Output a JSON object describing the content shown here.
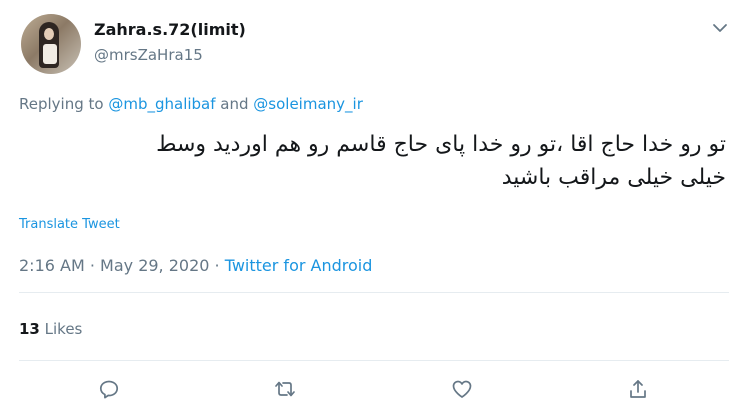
{
  "user": {
    "display_name": "Zahra.s.72(limit)",
    "handle": "@mrsZaHra15"
  },
  "reply": {
    "prefix": "Replying to ",
    "mention_1": "@mb_ghalibaf",
    "joiner": " and ",
    "mention_2": "@soleimany_ir"
  },
  "tweet": {
    "line_1": "تو رو خدا حاج اقا ،تو رو خدا پای حاج قاسم رو هم اوردید وسط",
    "line_2": "خیلی خیلی مراقب باشید"
  },
  "translate_label": "Translate Tweet",
  "meta": {
    "time": "2:16 AM",
    "separator_1": " · ",
    "date": "May 29, 2020",
    "separator_2": " · ",
    "source": "Twitter for Android"
  },
  "stats": {
    "likes_count": "13",
    "likes_label": " Likes"
  },
  "icons": {
    "more": "chevron-down-icon",
    "reply": "reply-icon",
    "retweet": "retweet-icon",
    "like": "heart-icon",
    "share": "share-icon"
  },
  "colors": {
    "link": "#1b95e0",
    "secondary_text": "#657786",
    "primary_text": "#14171a",
    "divider": "#e6ecf0"
  }
}
